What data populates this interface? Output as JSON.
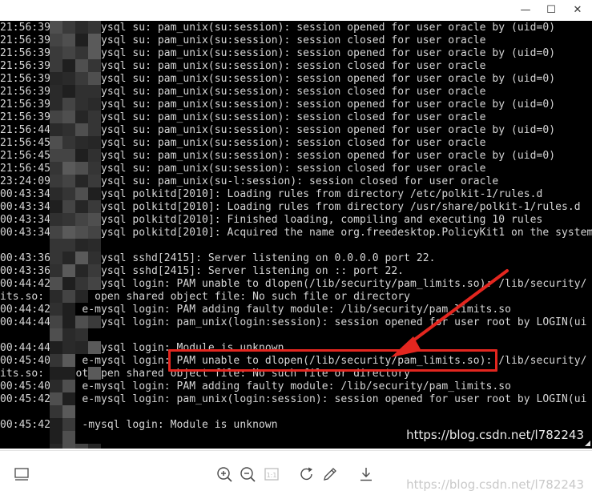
{
  "window": {
    "minimize_glyph": "—",
    "maximize_glyph": "☐",
    "close_glyph": "✕"
  },
  "terminal": {
    "lines": [
      "21:56:39 z   e-mysql su: pam_unix(su:session): session opened for user oracle by (uid=0)",
      "21:56:39 z   e-mysql su: pam_unix(su:session): session closed for user oracle",
      "21:56:39 z   e-mysql su: pam_unix(su:session): session opened for user oracle by (uid=0)",
      "21:56:39 z   e-mysql su: pam_unix(su:session): session closed for user oracle",
      "21:56:39 z   e-mysql su: pam_unix(su:session): session opened for user oracle by (uid=0)",
      "21:56:39 z   e-mysql su: pam_unix(su:session): session closed for user oracle",
      "21:56:39 z   e-mysql su: pam_unix(su:session): session opened for user oracle by (uid=0)",
      "21:56:39 z   e-mysql su: pam_unix(su:session): session closed for user oracle",
      "21:56:44 z   e-mysql su: pam_unix(su:session): session opened for user oracle by (uid=0)",
      "21:56:45 z   e-mysql su: pam_unix(su:session): session closed for user oracle",
      "21:56:45 z   e-mysql su: pam_unix(su:session): session opened for user oracle by (uid=0)",
      "21:56:45 z   e-mysql su: pam_unix(su:session): session closed for user oracle",
      "23:24:09 zj  e-mysql su: pam_unix(su-l:session): session closed for user oracle",
      "00:43:34 z   e-mysql polkitd[2010]: Loading rules from directory /etc/polkit-1/rules.d",
      "00:43:34 z   e-mysql polkitd[2010]: Loading rules from directory /usr/share/polkit-1/rules.d",
      "00:43:34 z   e-mysql polkitd[2010]: Finished loading, compiling and executing 10 rules",
      "00:43:34 z   e-mysql polkitd[2010]: Acquired the name org.freedesktop.PolicyKit1 on the system",
      "",
      "00:43:36 z   e-mysql sshd[2415]: Server listening on 0.0.0.0 port 22.",
      "00:43:36 z   e-mysql sshd[2415]: Server listening on :: port 22.",
      "00:44:42 z   e-mysql login: PAM unable to dlopen(/lib/security/pam_limits.so): /lib/security/",
      "its.so: cannot open shared object file: No such file or directory",
      "00:44:42 z   e-mysql login: PAM adding faulty module: /lib/security/pam_limits.so",
      "00:44:44 z   e-mysql login: pam_unix(login:session): session opened for user root by LOGIN(ui",
      "",
      "00:44:44 z   e-mysql login: Module is unknown",
      "00:45:40 z   e-mysql login: PAM unable to dlopen(/lib/security/pam_limits.so): /lib/security/",
      "its.so: cannot open shared object file: No such file or directory",
      "00:45:40 z   e-mysql login: PAM adding faulty module: /lib/security/pam_limits.so",
      "00:45:42 z   e-mysql login: pam_unix(login:session): session opened for user root by LOGIN(ui",
      "",
      "00:45:42 z   -mysql login: Module is unknown"
    ]
  },
  "watermarks": {
    "viewer": "https://blog.csdn.net/l782243",
    "toolbar": "https://blog.csdn.net/l782243"
  },
  "colors": {
    "terminal_bg": "#000000",
    "terminal_fg": "#d6d6d6",
    "annotation_red": "#e3261f"
  },
  "toolbar": {
    "icons": [
      "sidebar-icon",
      "zoom-in-icon",
      "zoom-out-icon",
      "actual-size-icon",
      "rotate-icon",
      "edit-icon",
      "download-icon"
    ],
    "actual_size_label": "1:1"
  }
}
